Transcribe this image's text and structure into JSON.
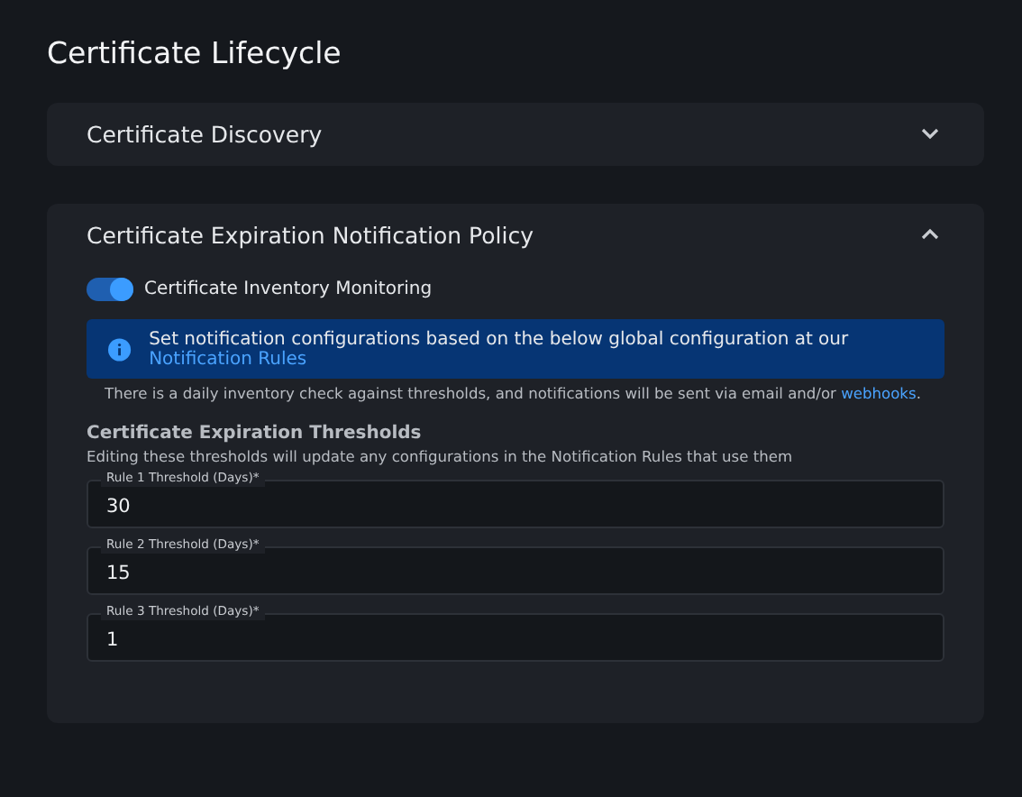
{
  "page": {
    "title": "Certificate Lifecycle"
  },
  "sections": [
    {
      "title": "Certificate Discovery",
      "expanded": false
    },
    {
      "title": "Certificate Expiration Notification Policy",
      "expanded": true
    }
  ],
  "policy": {
    "toggle": {
      "label": "Certificate Inventory Monitoring",
      "on": true
    },
    "banner": {
      "text": "Set notification configurations based on the below global configuration at our",
      "link": "Notification Rules"
    },
    "note": {
      "text": "There is a daily inventory check against thresholds, and notifications will be sent via email and/or",
      "link": "webhooks",
      "end": "."
    },
    "heading": "Certificate Expiration Thresholds",
    "subheading": "Editing these thresholds will update any configurations in the Notification Rules that use them",
    "fields": [
      {
        "label": "Rule 1 Threshold (Days)*",
        "value": "30"
      },
      {
        "label": "Rule 2 Threshold (Days)*",
        "value": "15"
      },
      {
        "label": "Rule 3 Threshold (Days)*",
        "value": "1"
      }
    ]
  }
}
